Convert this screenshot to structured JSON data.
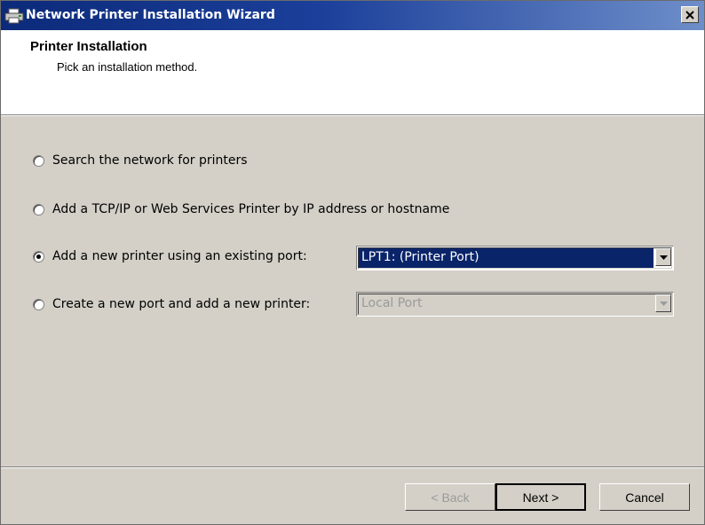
{
  "window": {
    "title": "Network Printer Installation Wizard",
    "icon": "printer-icon"
  },
  "header": {
    "title": "Printer Installation",
    "subtitle": "Pick an installation method."
  },
  "options": [
    {
      "label": "Search the network for printers",
      "selected": false
    },
    {
      "label": "Add a TCP/IP or Web Services Printer by IP address or hostname",
      "selected": false
    },
    {
      "label": "Add a new printer using an existing port:",
      "selected": true
    },
    {
      "label": "Create a new port and add a new printer:",
      "selected": false
    }
  ],
  "existing_port": {
    "value": "LPT1: (Printer Port)",
    "enabled": true
  },
  "new_port": {
    "value": "Local Port",
    "enabled": false
  },
  "buttons": {
    "back": "< Back",
    "next": "Next >",
    "cancel": "Cancel"
  },
  "colors": {
    "title_bar": "#0c2a7a",
    "selection": "#0a246a",
    "face": "#d4d0c8"
  }
}
